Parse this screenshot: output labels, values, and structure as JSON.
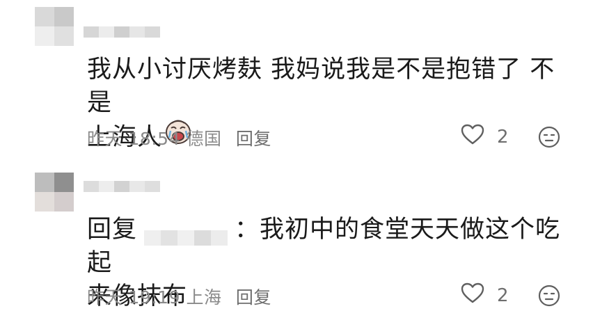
{
  "comments": [
    {
      "text_line1": "我从小讨厌烤麸 我妈说我是不是抱错了 不是",
      "text_line2": "上海人",
      "emoji_icon": "crying-face-sticker",
      "time": "昨天 18:54",
      "location": "德国",
      "reply_label": "回复",
      "likes": "2"
    },
    {
      "reply_prefix": "回复",
      "text_line1": "：我初中的食堂天天做这个吃起",
      "text_line2": "来像抹布",
      "time": "昨天 19:19",
      "location": "上海",
      "reply_label": "回复",
      "likes": "2"
    }
  ],
  "colors": {
    "meta": "#8a8a8a",
    "icon": "#6e6e6e",
    "blur_light": "#e8e8e8",
    "blur_dark": "#9a9a9a"
  }
}
